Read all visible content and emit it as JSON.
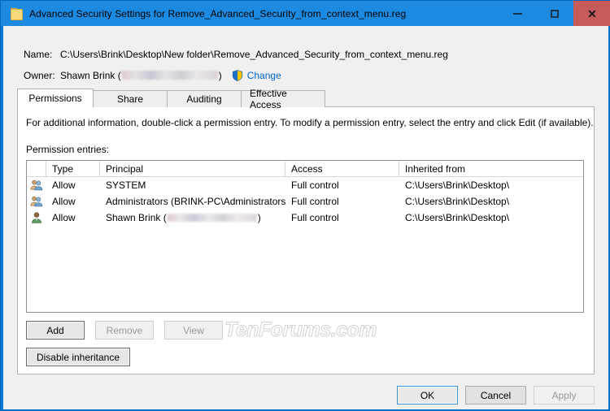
{
  "window": {
    "title": "Advanced Security Settings for Remove_Advanced_Security_from_context_menu.reg",
    "icon": "folder-icon",
    "controls": {
      "minimize": "–",
      "maximize": "❐",
      "close": "X"
    },
    "accent_color": "#1b8ae0",
    "close_color": "#c75b5b"
  },
  "fields": {
    "name_label": "Name:",
    "name_value": "C:\\Users\\Brink\\Desktop\\New folder\\Remove_Advanced_Security_from_context_menu.reg",
    "owner_label": "Owner:",
    "owner_value": "Shawn Brink (",
    "owner_value_end": ")",
    "owner_redacted": true,
    "change_link": "Change",
    "change_icon": "uac-shield-icon"
  },
  "tabs": [
    {
      "label": "Permissions",
      "active": true
    },
    {
      "label": "Share",
      "active": false
    },
    {
      "label": "Auditing",
      "active": false
    },
    {
      "label": "Effective Access",
      "active": false
    }
  ],
  "panel": {
    "info_text": "For additional information, double-click a permission entry. To modify a permission entry, select the entry and click Edit (if available).",
    "entries_label": "Permission entries:"
  },
  "table": {
    "columns": [
      "",
      "Type",
      "Principal",
      "Access",
      "Inherited from"
    ],
    "rows": [
      {
        "icon": "group-icon",
        "type": "Allow",
        "principal": "SYSTEM",
        "principal_redacted": false,
        "access": "Full control",
        "inherited_from": "C:\\Users\\Brink\\Desktop\\"
      },
      {
        "icon": "group-icon",
        "type": "Allow",
        "principal": "Administrators (BRINK-PC\\Administrators)",
        "principal_redacted": false,
        "access": "Full control",
        "inherited_from": "C:\\Users\\Brink\\Desktop\\"
      },
      {
        "icon": "user-icon",
        "type": "Allow",
        "principal": "Shawn Brink (",
        "principal_end": ")",
        "principal_redacted": true,
        "access": "Full control",
        "inherited_from": "C:\\Users\\Brink\\Desktop\\"
      }
    ]
  },
  "watermark": "TenForums.com",
  "buttons": {
    "add": "Add",
    "remove": "Remove",
    "view": "View",
    "disable_inheritance": "Disable inheritance",
    "ok": "OK",
    "cancel": "Cancel",
    "apply": "Apply"
  }
}
